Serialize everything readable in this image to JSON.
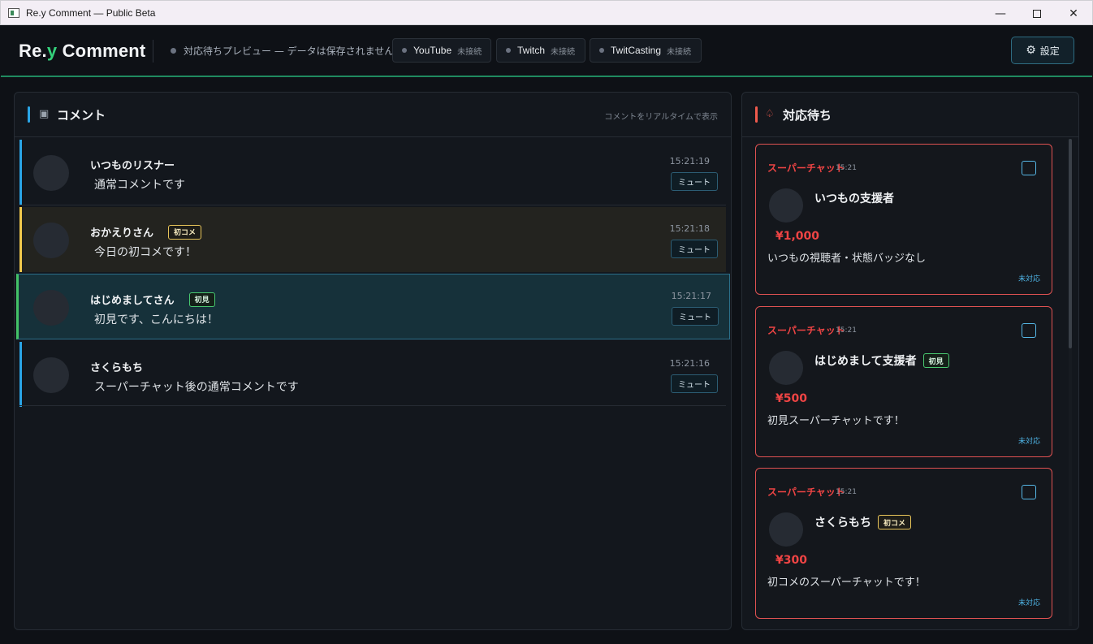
{
  "window": {
    "title": "Re.y Comment — Public Beta",
    "min": "—",
    "close": "✕"
  },
  "header": {
    "brand_pre": "Re.",
    "brand_y": "y",
    "brand_post": " Comment",
    "status": "対応待ちプレビュー — データは保存されません",
    "services": [
      {
        "name": "YouTube",
        "state": "未接続"
      },
      {
        "name": "Twitch",
        "state": "未接続"
      },
      {
        "name": "TwitCasting",
        "state": "未接続"
      }
    ],
    "settings_label": "設定",
    "accent": "#1f8a5f"
  },
  "comments_panel": {
    "title": "コメント",
    "subtitle": "コメントをリアルタイムで表示",
    "icon": "comment-square-icon",
    "bar_color": "#2aa5e6",
    "rows": [
      {
        "name": "いつものリスナー",
        "text": "通常コメントです",
        "time": "15:21:19",
        "badge": "",
        "mute": "ミュート",
        "accent": "#2aa5e6",
        "bg": "#13171d"
      },
      {
        "name": "おかえりさん",
        "text": "今日の初コメです！",
        "time": "15:21:18",
        "badge": "初コメ",
        "mute": "ミュート",
        "accent": "#f2c94c",
        "bg": "#23231f"
      },
      {
        "name": "はじめましてさん",
        "text": "初見です、こんにちは！",
        "time": "15:21:17",
        "badge": "初見",
        "mute": "ミュート",
        "accent": "#43c267",
        "bg": "#16313a"
      },
      {
        "name": "さくらもち",
        "text": "スーパーチャット後の通常コメントです",
        "time": "15:21:16",
        "badge": "",
        "mute": "ミュート",
        "accent": "#2aa5e6",
        "bg": "#13171d"
      }
    ]
  },
  "pending_panel": {
    "title": "対応待ち",
    "icon": "bell-icon",
    "bar_color": "#ef5a4d",
    "cards": [
      {
        "type": "スーパーチャット",
        "time": "15:21",
        "name": "いつもの支援者",
        "badge": "",
        "amount": "¥1,000",
        "message": "いつもの視聴者・状態バッジなし",
        "state": "未対応"
      },
      {
        "type": "スーパーチャット",
        "time": "15:21",
        "name": "はじめまして支援者",
        "badge": "初見",
        "amount": "¥500",
        "message": "初見スーパーチャットです！",
        "state": "未対応"
      },
      {
        "type": "スーパーチャット",
        "time": "15:21",
        "name": "さくらもち",
        "badge": "初コメ",
        "amount": "¥300",
        "message": "初コメのスーパーチャットです！",
        "state": "未対応"
      }
    ]
  }
}
